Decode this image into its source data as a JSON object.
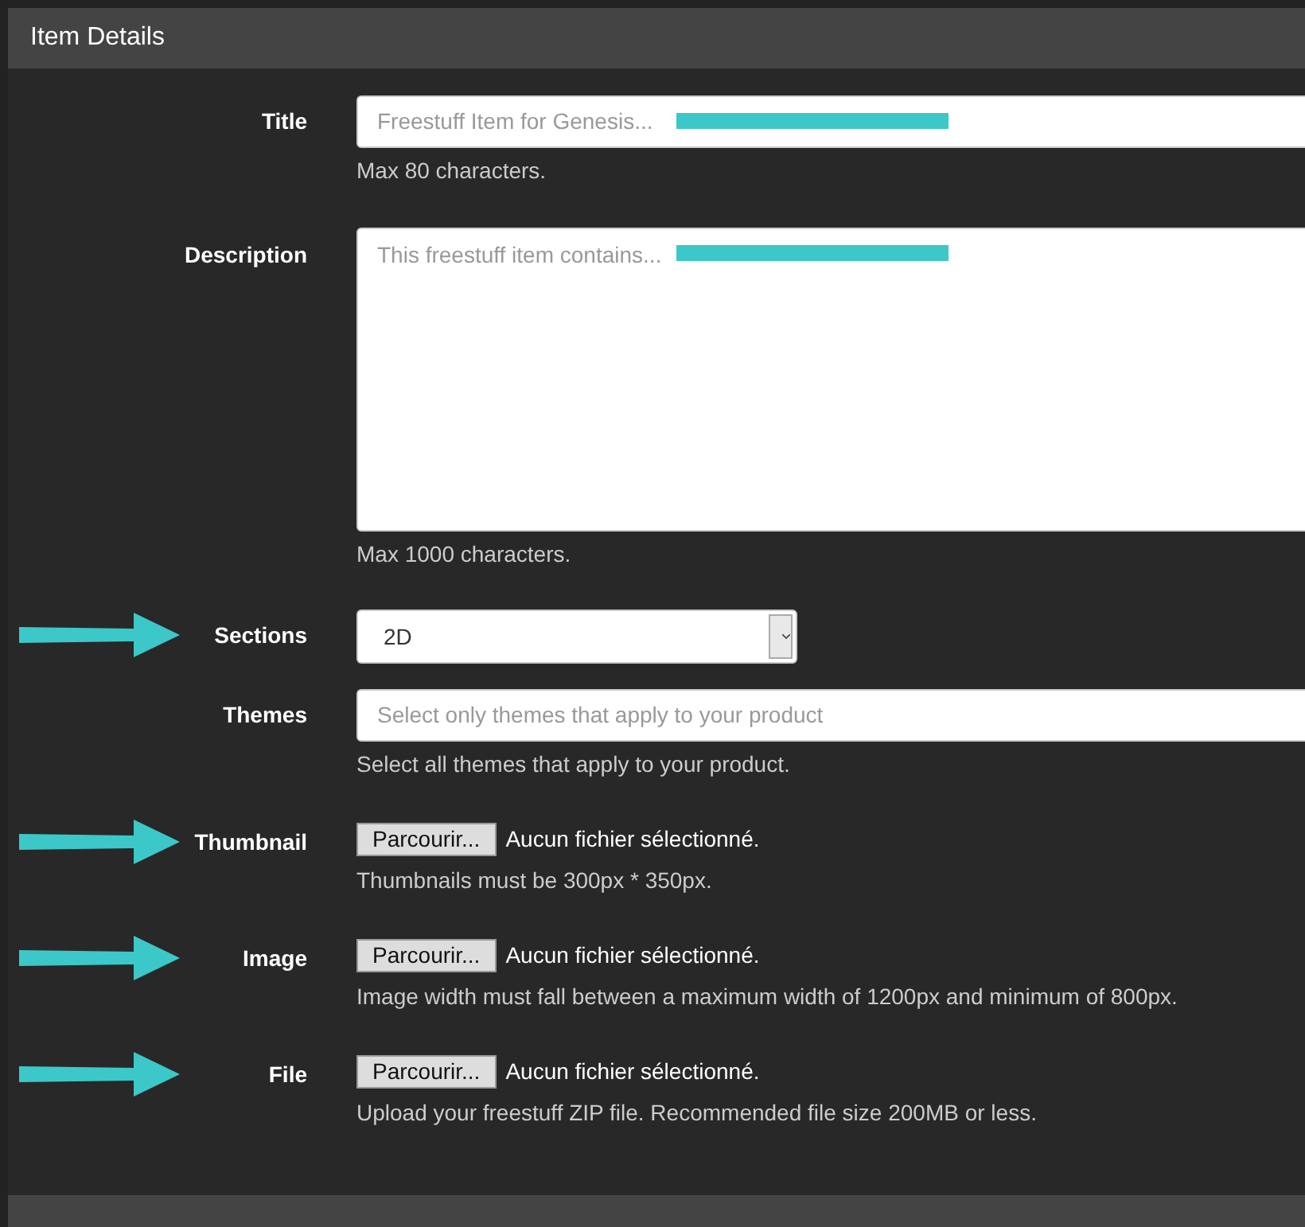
{
  "panel": {
    "title": "Item Details"
  },
  "rows": [
    {
      "kind": "text",
      "label": "Title",
      "placeholder": "Freestuff Item for Genesis...",
      "redacted": true,
      "arrow": false,
      "help": "Max 80 characters."
    },
    {
      "kind": "textarea",
      "label": "Description",
      "placeholder": "This freestuff item contains...",
      "redacted": true,
      "arrow": false,
      "help": "Max 1000 characters."
    },
    {
      "kind": "select",
      "label": "Sections",
      "value": "2D",
      "arrow": true
    },
    {
      "kind": "text",
      "label": "Themes",
      "placeholder": "Select only themes that apply to your product",
      "redacted": false,
      "arrow": false,
      "help": "Select all themes that apply to your product."
    },
    {
      "kind": "file",
      "label": "Thumbnail",
      "button": "Parcourir...",
      "status": "Aucun fichier sélectionné.",
      "arrow": true,
      "help": "Thumbnails must be 300px * 350px."
    },
    {
      "kind": "file",
      "label": "Image",
      "button": "Parcourir...",
      "status": "Aucun fichier sélectionné.",
      "arrow": true,
      "help": "Image width must fall between a maximum width of 1200px and minimum of 800px."
    },
    {
      "kind": "file",
      "label": "File",
      "button": "Parcourir...",
      "status": "Aucun fichier sélectionné.",
      "arrow": true,
      "help": "Upload your freestuff ZIP file. Recommended file size 200MB or less."
    }
  ]
}
